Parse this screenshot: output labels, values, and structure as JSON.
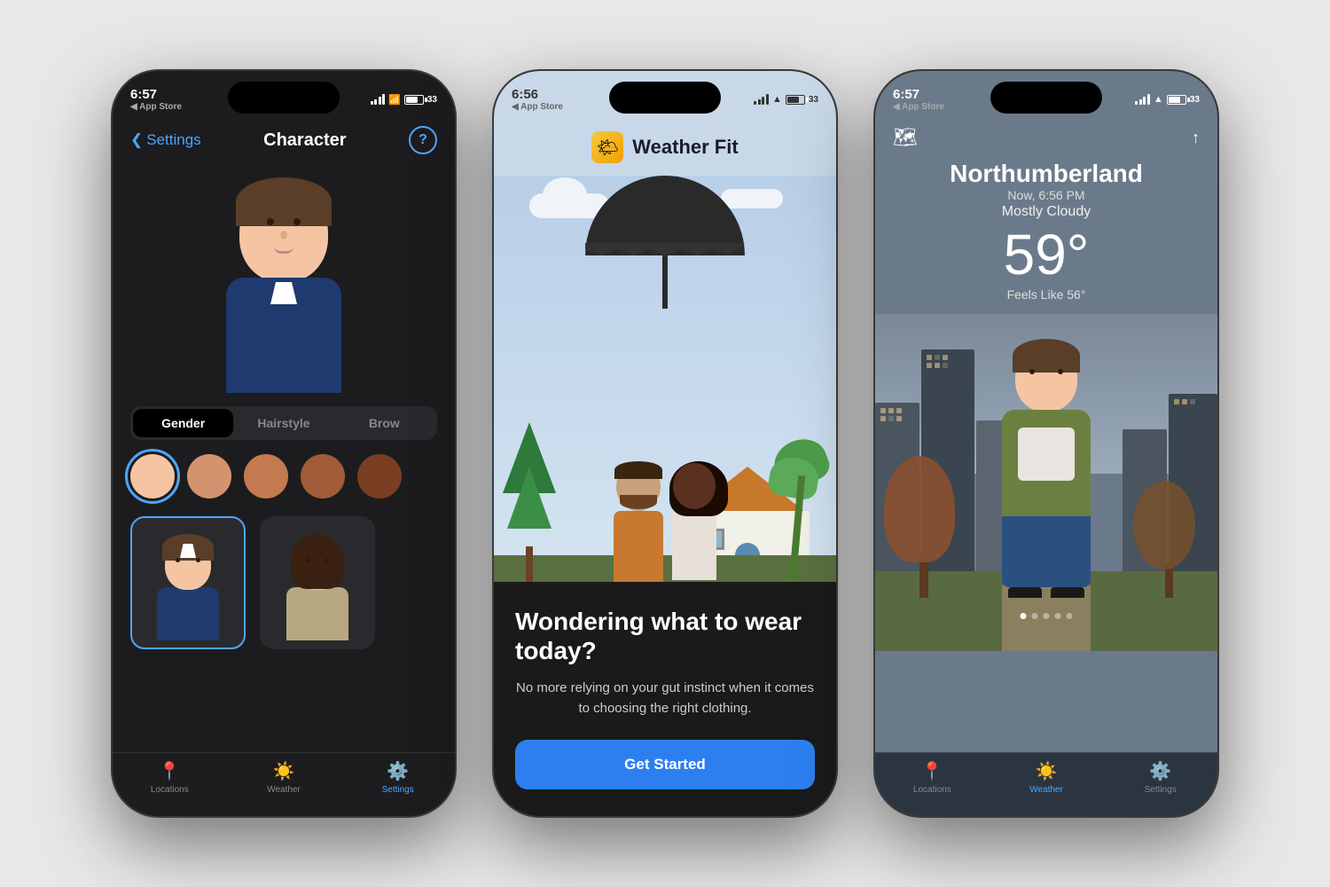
{
  "phones": {
    "phone1": {
      "status": {
        "time": "6:57",
        "store": "App Store",
        "battery": "33"
      },
      "nav": {
        "back_label": "Settings",
        "title": "Character",
        "help_label": "?"
      },
      "tabs": [
        "Gender",
        "Hairstyle",
        "Brow"
      ],
      "active_tab": 0,
      "skin_swatches": [
        "#f5c5a3",
        "#d4936e",
        "#c47a50",
        "#a05c38",
        "#7a3e22"
      ],
      "characters": [
        "male",
        "female"
      ],
      "tab_bar": {
        "items": [
          {
            "label": "Locations",
            "icon": "📍"
          },
          {
            "label": "Weather",
            "icon": "☀️"
          },
          {
            "label": "Settings",
            "icon": "⚙️"
          }
        ],
        "active": 2
      }
    },
    "phone2": {
      "status": {
        "time": "6:56",
        "store": "App Store",
        "battery": "33"
      },
      "app": {
        "icon": "🌤",
        "name": "Weather Fit"
      },
      "headline": "Wondering what to wear today?",
      "subtext": "No more relying on your gut instinct when it comes to choosing the right clothing.",
      "button_label": "Get Started"
    },
    "phone3": {
      "status": {
        "time": "6:57",
        "store": "App Store",
        "battery": "33"
      },
      "location": {
        "city": "Northumberland",
        "time_label": "Now, 6:56 PM",
        "condition": "Mostly Cloudy",
        "temperature": "59°",
        "feels_like": "Feels Like 56°"
      },
      "tab_bar": {
        "items": [
          {
            "label": "Locations",
            "icon": "📍"
          },
          {
            "label": "Weather",
            "icon": "☀️"
          },
          {
            "label": "Settings",
            "icon": "⚙️"
          }
        ],
        "active": 1
      },
      "dots": 5,
      "active_dot": 0
    }
  }
}
